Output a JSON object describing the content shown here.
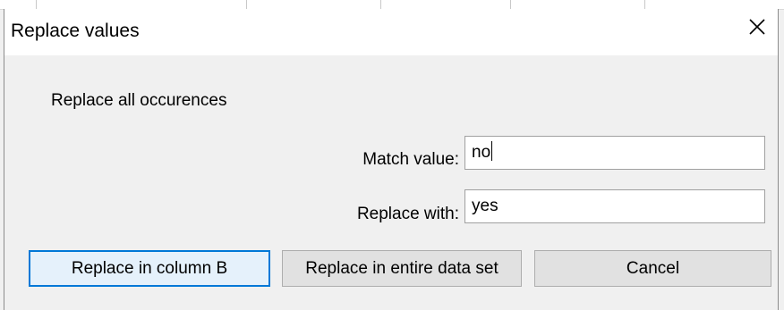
{
  "dialog": {
    "title": "Replace values",
    "close_glyph": "✕",
    "intro_text": "Replace all occurences"
  },
  "fields": {
    "match_label": "Match value:",
    "match_value": "no",
    "replace_label": "Replace with:",
    "replace_value": "yes"
  },
  "buttons": {
    "replace_column": "Replace in column B",
    "replace_all": "Replace in entire data set",
    "cancel": "Cancel"
  },
  "colors": {
    "default_button_border": "#0078d7",
    "default_button_fill": "#e5f1fb",
    "dialog_background": "#f0f0f0"
  },
  "icons": {
    "close": "close-icon"
  }
}
